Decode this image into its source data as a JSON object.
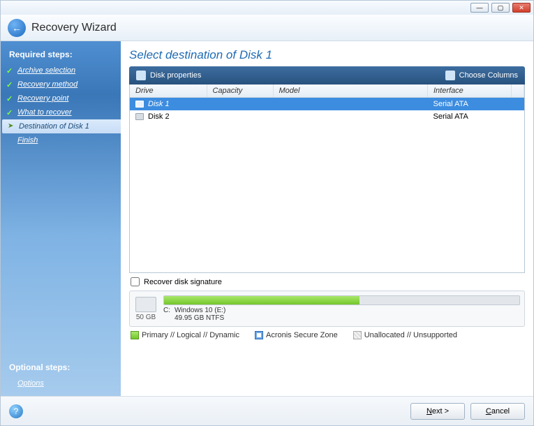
{
  "titlebar": {
    "min": "—",
    "max": "▢",
    "close": "✕"
  },
  "header": {
    "title": "Recovery Wizard"
  },
  "sidebar": {
    "required_label": "Required steps:",
    "optional_label": "Optional steps:",
    "items": [
      {
        "label": "Archive selection",
        "state": "done"
      },
      {
        "label": "Recovery method",
        "state": "done"
      },
      {
        "label": "Recovery point",
        "state": "done"
      },
      {
        "label": "What to recover",
        "state": "done"
      },
      {
        "label": "Destination of Disk 1",
        "state": "current"
      },
      {
        "label": "Finish",
        "state": "plain"
      }
    ],
    "optional_items": [
      {
        "label": "Options"
      }
    ]
  },
  "main": {
    "title": "Select destination of Disk 1",
    "toolbar": {
      "properties": "Disk properties",
      "columns": "Choose Columns"
    },
    "columns": {
      "drive": "Drive",
      "capacity": "Capacity",
      "model": "Model",
      "interface": "Interface"
    },
    "rows": [
      {
        "drive": "Disk 1",
        "capacity": "",
        "model": "",
        "interface": "Serial ATA",
        "selected": true
      },
      {
        "drive": "Disk 2",
        "capacity": "",
        "model": "",
        "interface": "Serial ATA",
        "selected": false
      }
    ],
    "recover_sig": "Recover disk signature",
    "usage": {
      "disk_size": "50 GB",
      "drive_letter": "C:",
      "partition_name": "Windows 10 (E:)",
      "partition_info": "49.95 GB  NTFS"
    },
    "legend": {
      "primary": "Primary // Logical // Dynamic",
      "secure": "Acronis Secure Zone",
      "unalloc": "Unallocated // Unsupported"
    }
  },
  "footer": {
    "next": "Next >",
    "cancel": "Cancel"
  }
}
